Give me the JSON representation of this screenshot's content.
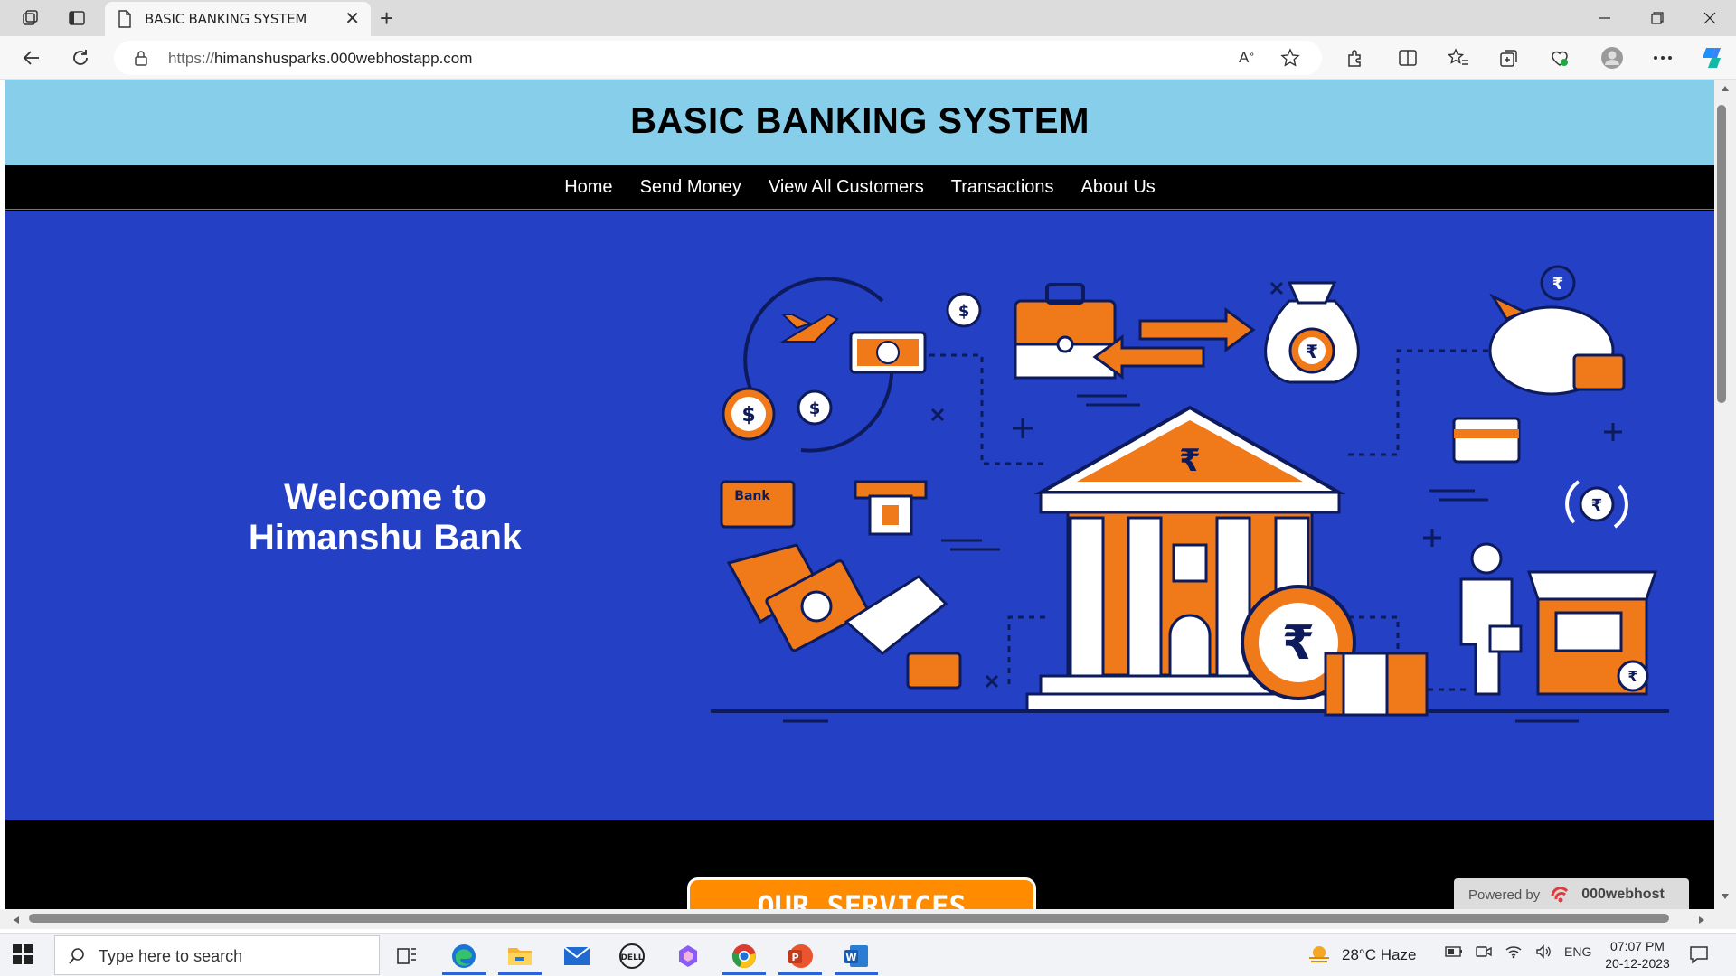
{
  "browser": {
    "tab_title": "BASIC BANKING SYSTEM",
    "url_protocol": "https://",
    "url_host": "himanshusparks.000webhostapp.com",
    "new_tab_symbol": "+",
    "close_symbol": "✕"
  },
  "site": {
    "title": "BASIC BANKING SYSTEM",
    "nav": [
      "Home",
      "Send Money",
      "View All Customers",
      "Transactions",
      "About Us"
    ],
    "welcome_line1": "Welcome to",
    "welcome_line2": "Himanshu Bank",
    "services_label": "OUR SERVICES",
    "powered_by": "Powered by",
    "host_brand": "000webhost",
    "illustration_labels": {
      "bank_card": "Bank",
      "rupee": "₹",
      "dollar": "$"
    }
  },
  "taskbar": {
    "search_placeholder": "Type here to search",
    "weather": "28°C Haze",
    "language": "ENG",
    "time": "07:07 PM",
    "date": "20-12-2023"
  },
  "colors": {
    "header_bg": "#87ceeb",
    "hero_bg": "#2440c4",
    "accent_orange": "#ff8c00"
  }
}
